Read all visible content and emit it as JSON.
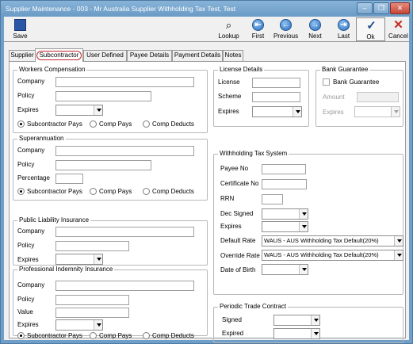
{
  "window": {
    "title": "Supplier Maintenance - 003 - Mr Australia Supplier Withholding Tax Test, Test",
    "controls": [
      "minimize-icon",
      "restore-icon",
      "close-icon"
    ]
  },
  "toolbar": {
    "save": {
      "label": "Save",
      "icon": "disk-icon"
    },
    "lookup": {
      "label": "Lookup",
      "icon": "binoculars-icon"
    },
    "first": {
      "label": "First",
      "icon": "first-icon"
    },
    "previous": {
      "label": "Previous",
      "icon": "previous-icon"
    },
    "next": {
      "label": "Next",
      "icon": "next-icon"
    },
    "last": {
      "label": "Last",
      "icon": "last-icon"
    },
    "ok": {
      "label": "Ok",
      "icon": "check-icon"
    },
    "cancel": {
      "label": "Cancel",
      "icon": "cross-icon"
    }
  },
  "tabs": [
    "Supplier",
    "Subcontractor",
    "User Defined",
    "Payee Details",
    "Payment Details",
    "Notes"
  ],
  "active_tab": "Subcontractor",
  "workers_comp": {
    "title": "Workers Compensation",
    "company": "Company",
    "policy": "Policy",
    "expires": "Expires",
    "radios": [
      "Subcontractor Pays",
      "Comp Pays",
      "Comp Deducts"
    ]
  },
  "superannuation": {
    "title": "Superannuation",
    "company": "Company",
    "policy": "Policy",
    "percentage": "Percentage",
    "radios": [
      "Subcontractor Pays",
      "Comp Pays",
      "Comp Deducts"
    ]
  },
  "public_liability": {
    "title": "Public Liability Insurance",
    "company": "Company",
    "policy": "Policy",
    "expires": "Expires"
  },
  "professional_indemnity": {
    "title": "Professional Indemnity Insurance",
    "company": "Company",
    "policy": "Policy",
    "value": "Value",
    "expires": "Expires",
    "radios": [
      "Subcontractor Pays",
      "Comp Pays",
      "Comp Deducts"
    ]
  },
  "license": {
    "title": "License Details",
    "license": "License",
    "scheme": "Scheme",
    "expires": "Expires"
  },
  "bank_guarantee": {
    "title": "Bank Guarantee",
    "checkbox": "Bank Guarantee",
    "amount": "Amount",
    "expires": "Expires"
  },
  "withholding": {
    "title": "Withholding Tax System",
    "payee_no": "Payee No",
    "certificate_no": "Certificate No",
    "rrn": "RRN",
    "dec_signed": "Dec Signed",
    "expires": "Expires",
    "default_rate": "Default Rate",
    "override_rate": "Override Rate",
    "date_of_birth": "Date of Birth",
    "default_rate_value": "WAUS - AUS Withholding Tax Default(20%)",
    "override_rate_value": "WAUS - AUS Withholding Tax Default(20%)"
  },
  "periodic": {
    "title": "Periodic Trade Contract",
    "signed": "Signed",
    "expired": "Expired"
  }
}
